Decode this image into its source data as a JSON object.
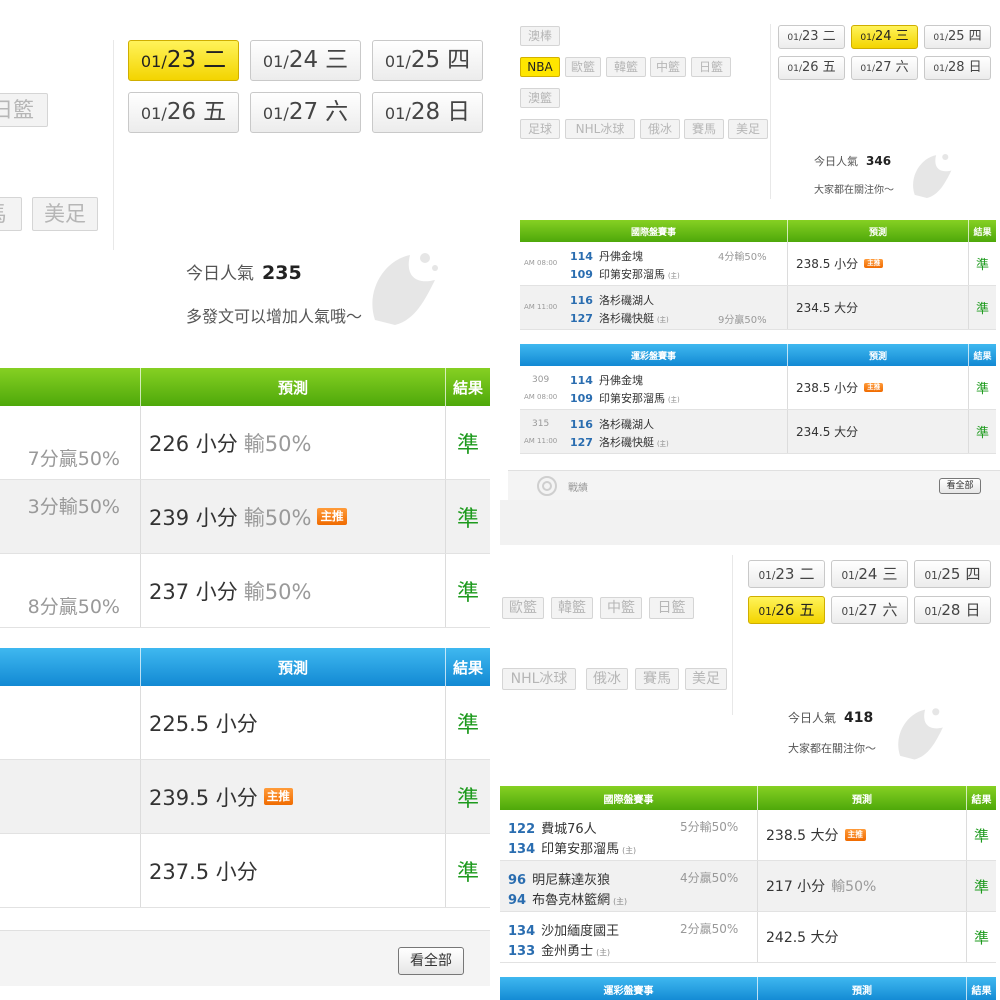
{
  "p1": {
    "dates": [
      {
        "mo": "01/",
        "day": "23",
        "wd": "二",
        "active": true
      },
      {
        "mo": "01/",
        "day": "24",
        "wd": "三",
        "active": false
      },
      {
        "mo": "01/",
        "day": "25",
        "wd": "四",
        "active": false
      },
      {
        "mo": "01/",
        "day": "26",
        "wd": "五",
        "active": false
      },
      {
        "mo": "01/",
        "day": "27",
        "wd": "六",
        "active": false
      },
      {
        "mo": "01/",
        "day": "28",
        "wd": "日",
        "active": false
      }
    ],
    "tags": [
      "日籃",
      "馬",
      "美足"
    ],
    "popularity": {
      "label": "今日人氣",
      "count": "235",
      "sub": "多發文可以增加人氣哦～"
    },
    "intl": {
      "headers": {
        "pred": "預測",
        "result": "結果"
      },
      "rows": [
        {
          "handicap": "7分贏50%",
          "pred": "226 小分",
          "sub": "輸50%",
          "badge": "",
          "result": "準"
        },
        {
          "handicap": "3分輸50%",
          "pred": "239 小分",
          "sub": "輸50%",
          "badge": "主推",
          "result": "準"
        },
        {
          "handicap": "8分贏50%",
          "pred": "237 小分",
          "sub": "輸50%",
          "badge": "",
          "result": "準"
        }
      ]
    },
    "lottery": {
      "headers": {
        "pred": "預測",
        "result": "結果"
      },
      "rows": [
        {
          "pred": "225.5 小分",
          "badge": "",
          "result": "準"
        },
        {
          "pred": "239.5 小分",
          "badge": "主推",
          "result": "準"
        },
        {
          "pred": "237.5 小分",
          "badge": "",
          "result": "準"
        }
      ]
    },
    "see_all": "看全部"
  },
  "p2": {
    "dates": [
      {
        "mo": "01/",
        "day": "23",
        "wd": "二",
        "active": false
      },
      {
        "mo": "01/",
        "day": "24",
        "wd": "三",
        "active": true
      },
      {
        "mo": "01/",
        "day": "25",
        "wd": "四",
        "active": false
      },
      {
        "mo": "01/",
        "day": "26",
        "wd": "五",
        "active": false
      },
      {
        "mo": "01/",
        "day": "27",
        "wd": "六",
        "active": false
      },
      {
        "mo": "01/",
        "day": "28",
        "wd": "日",
        "active": false
      }
    ],
    "tags": [
      {
        "label": "澳棒",
        "active": false
      },
      {
        "label": "NBA",
        "active": true
      },
      {
        "label": "歐籃",
        "active": false
      },
      {
        "label": "韓籃",
        "active": false
      },
      {
        "label": "中籃",
        "active": false
      },
      {
        "label": "日籃",
        "active": false
      },
      {
        "label": "澳籃",
        "active": false
      },
      {
        "label": "足球",
        "active": false
      },
      {
        "label": "NHL冰球",
        "active": false
      },
      {
        "label": "俄冰",
        "active": false
      },
      {
        "label": "賽馬",
        "active": false
      },
      {
        "label": "美足",
        "active": false
      }
    ],
    "popularity": {
      "label": "今日人氣",
      "count": "346",
      "sub": "大家都在關注你～"
    },
    "intl": {
      "headers": {
        "title": "國際盤賽事",
        "pred": "預測",
        "result": "結果"
      },
      "rows": [
        {
          "time": "AM 08:00",
          "t1num": "114",
          "t1": "丹佛金塊",
          "t2num": "109",
          "t2": "印第安那溜馬",
          "home": "(主)",
          "handicap": "4分輸50%",
          "hpos": "top",
          "pred": "238.5 小分",
          "badge": "主推",
          "result": "準"
        },
        {
          "time": "AM 11:00",
          "t1num": "116",
          "t1": "洛杉磯湖人",
          "t2num": "127",
          "t2": "洛杉磯快艇",
          "home": "(主)",
          "handicap": "9分贏50%",
          "hpos": "bottom",
          "pred": "234.5 大分",
          "badge": "",
          "result": "準"
        }
      ]
    },
    "lottery": {
      "headers": {
        "title": "運彩盤賽事",
        "pred": "預測",
        "result": "結果"
      },
      "rows": [
        {
          "code": "309",
          "time": "AM 08:00",
          "t1num": "114",
          "t1": "丹佛金塊",
          "t2num": "109",
          "t2": "印第安那溜馬",
          "home": "(主)",
          "pred": "238.5 小分",
          "badge": "主推",
          "result": "準"
        },
        {
          "code": "315",
          "time": "AM 11:00",
          "t1num": "116",
          "t1": "洛杉磯湖人",
          "t2num": "127",
          "t2": "洛杉磯快艇",
          "home": "(主)",
          "pred": "234.5 大分",
          "badge": "",
          "result": "準"
        }
      ]
    },
    "footer_label": "戰績",
    "see_all": "看全部"
  },
  "p3": {
    "dates": [
      {
        "mo": "01/",
        "day": "23",
        "wd": "二",
        "active": false
      },
      {
        "mo": "01/",
        "day": "24",
        "wd": "三",
        "active": false
      },
      {
        "mo": "01/",
        "day": "25",
        "wd": "四",
        "active": false
      },
      {
        "mo": "01/",
        "day": "26",
        "wd": "五",
        "active": true
      },
      {
        "mo": "01/",
        "day": "27",
        "wd": "六",
        "active": false
      },
      {
        "mo": "01/",
        "day": "28",
        "wd": "日",
        "active": false
      }
    ],
    "tags": [
      "歐籃",
      "韓籃",
      "中籃",
      "日籃",
      "NHL冰球",
      "俄冰",
      "賽馬",
      "美足"
    ],
    "popularity": {
      "label": "今日人氣",
      "count": "418",
      "sub": "大家都在關注你～"
    },
    "intl": {
      "headers": {
        "title": "國際盤賽事",
        "pred": "預測",
        "result": "結果"
      },
      "rows": [
        {
          "t1num": "122",
          "t1": "費城76人",
          "t2num": "134",
          "t2": "印第安那溜馬",
          "home": "(主)",
          "handicap": "5分輸50%",
          "pred": "238.5 大分",
          "sub": "",
          "badge": "主推",
          "result": "準"
        },
        {
          "t1num": "96",
          "t1": "明尼蘇達灰狼",
          "t2num": "94",
          "t2": "布魯克林籃網",
          "home": "(主)",
          "handicap": "4分贏50%",
          "pred": "217 小分",
          "sub": "輸50%",
          "badge": "",
          "result": "準"
        },
        {
          "t1num": "134",
          "t1": "沙加緬度國王",
          "t2num": "133",
          "t2": "金州勇士",
          "home": "(主)",
          "handicap": "2分贏50%",
          "pred": "242.5 大分",
          "sub": "",
          "badge": "",
          "result": "準"
        }
      ]
    },
    "lottery": {
      "headers": {
        "title": "運彩盤賽事",
        "pred": "預測",
        "result": "結果"
      }
    }
  }
}
